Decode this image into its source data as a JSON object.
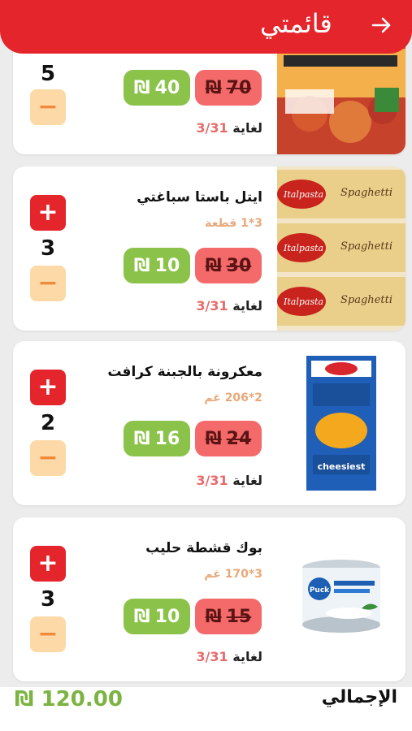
{
  "header": {
    "title": "قائمتي",
    "back_icon": "arrow-right-icon"
  },
  "currency_symbol": "₪",
  "items": [
    {
      "name": "",
      "qty_label": "",
      "old_price": "70",
      "new_price": "40",
      "until": "لغاية",
      "date": "3/31",
      "qty": "5",
      "image": "spicy-chicken-ramen-pack"
    },
    {
      "name": "ايتل باستا سباغتي",
      "qty_label": "3*1 قطعة",
      "old_price": "30",
      "new_price": "10",
      "until": "لغاية",
      "date": "3/31",
      "qty": "3",
      "image": "italpasta-spaghetti-packs"
    },
    {
      "name": "معكرونة بالجبنة كرافت",
      "qty_label": "2*206 غم",
      "old_price": "24",
      "new_price": "16",
      "until": "لغاية",
      "date": "3/31",
      "qty": "2",
      "image": "kraft-macaroni-cheese-box"
    },
    {
      "name": "بوك قشطة حليب",
      "qty_label": "3*170 غم",
      "old_price": "15",
      "new_price": "10",
      "until": "لغاية",
      "date": "3/31",
      "qty": "3",
      "image": "puck-cream-can"
    }
  ],
  "footer": {
    "total_label": "الإجمالي",
    "total_value": "120.00"
  },
  "colors": {
    "brand_red": "#e4252b",
    "price_green": "#8bc34a",
    "old_price_red": "#f46a6a",
    "minus_bg": "#fcd9a6"
  }
}
